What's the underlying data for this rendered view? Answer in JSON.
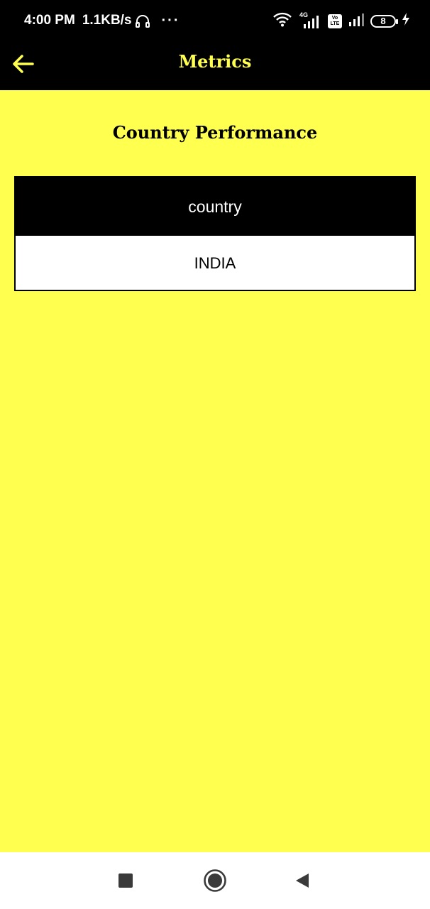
{
  "status_bar": {
    "time": "4:00 PM",
    "net_speed": "1.1KB/s",
    "more": "···",
    "net_type": "4G",
    "volte": "Vo LTE",
    "battery": "8",
    "icons": [
      "headphones-icon",
      "wifi-icon",
      "signal-icon",
      "volte-icon",
      "signal-icon",
      "battery-icon",
      "charging-icon"
    ]
  },
  "app_bar": {
    "title": "Metrics",
    "back_icon": "arrow-left-icon",
    "accent_color": "#ffff4f"
  },
  "section": {
    "title": "Country Performance"
  },
  "table": {
    "header": "country",
    "rows": [
      "INDIA"
    ]
  },
  "nav_bar": {
    "icons": [
      "recents-square-icon",
      "home-circle-icon",
      "back-triangle-icon"
    ]
  },
  "colors": {
    "background": "#ffff4f",
    "bars": "#000000",
    "table_body": "#ffffff"
  }
}
